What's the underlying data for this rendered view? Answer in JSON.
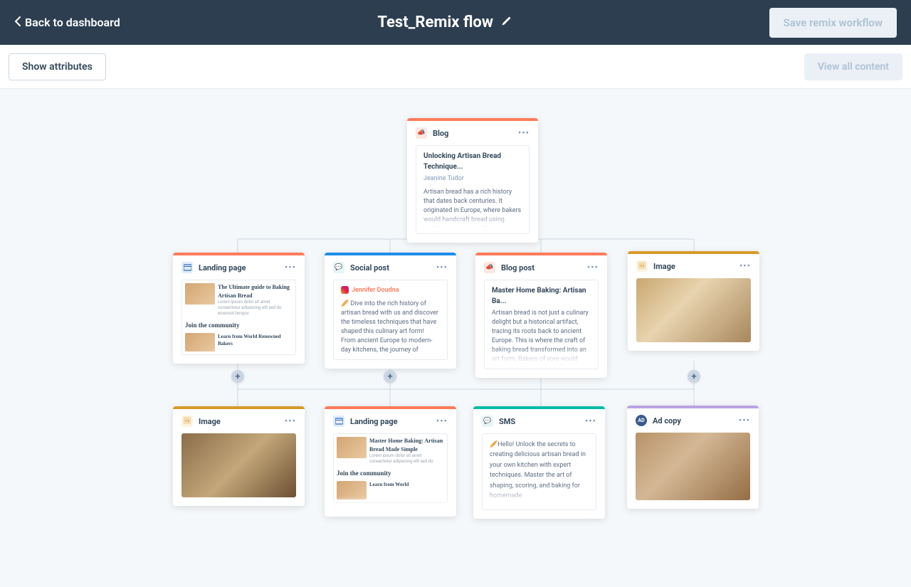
{
  "header": {
    "back_label": "Back to dashboard",
    "title": "Test_Remix flow",
    "save_label": "Save remix workflow"
  },
  "toolbar": {
    "show_attrs_label": "Show attributes",
    "view_all_label": "View all content"
  },
  "root_card": {
    "type": "Blog",
    "title": "Unlocking Artisan Bread Technique...",
    "author": "Jeanine Tudor",
    "body": "Artisan bread has a rich history that dates back centuries. It originated in Europe, where bakers would handcraft bread using traditional methods. These breads were made with simple ingredients and had a distinctive taste and texture. Over time,"
  },
  "row2": {
    "landing": {
      "type": "Landing page",
      "heading": "The Ultimate guide to Baking Artisan Bread",
      "sub": "Lorem ipsum dolor sit amet consectetur adipiscing elit sed do eiusmod tempor",
      "community": "Join the community",
      "learn": "Learn from World Renowned Bakers"
    },
    "social": {
      "type": "Social post",
      "author": "Jennifer Doudna",
      "body": "🥖 Dive into the rich history of artisan bread with us and discover the timeless techniques that have shaped this culinary art form! From ancient Europe to modern-day kitchens, the journey of crafting the perfect loaf is a testament to human creativity and tradition. 👨‍🍳🔥 #ArtisanBread #BakingHistory #CulinaryTraditions"
    },
    "blogpost": {
      "type": "Blog post",
      "title": "Master Home Baking: Artisan Ba...",
      "body": "Artisan bread is not just a culinary delight but a historical artifact, tracing its roots back to ancient Europe. This is where the craft of baking bread transformed into an art form. Bakers of yore would meticulously handcraft each loaf, adhering to time-honored techniques that valued simplicity and"
    },
    "image": {
      "type": "Image"
    }
  },
  "row3": {
    "image": {
      "type": "Image"
    },
    "landing": {
      "type": "Landing page",
      "heading": "Master Home Baking: Artisan Bread Made Simple",
      "sub": "Lorem ipsum dolor sit amet consectetur adipiscing elit sed do",
      "community": "Join the community",
      "learn": "Learn from World"
    },
    "sms": {
      "type": "SMS",
      "body": "🥖Hello! Unlock the secrets to creating delicious artisan bread in your own kitchen with expert techniques. Master the art of shaping, scoring, and baking for homemade"
    },
    "adcopy": {
      "type": "Ad copy"
    }
  }
}
